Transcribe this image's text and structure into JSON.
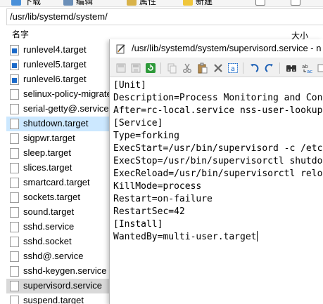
{
  "toolbar": {
    "download_label": "下载",
    "edit_label": "编辑",
    "properties_label": "属性",
    "new_label": "新建"
  },
  "path": "/usr/lib/systemd/system/",
  "columns": {
    "name": "名字",
    "size": "大小"
  },
  "files": [
    {
      "name": "runlevel4.target",
      "link": true
    },
    {
      "name": "runlevel5.target",
      "link": true
    },
    {
      "name": "runlevel6.target",
      "link": true
    },
    {
      "name": "selinux-policy-migrate",
      "link": false
    },
    {
      "name": "serial-getty@.service",
      "link": false
    },
    {
      "name": "shutdown.target",
      "link": false
    },
    {
      "name": "sigpwr.target",
      "link": false
    },
    {
      "name": "sleep.target",
      "link": false
    },
    {
      "name": "slices.target",
      "link": false
    },
    {
      "name": "smartcard.target",
      "link": false
    },
    {
      "name": "sockets.target",
      "link": false
    },
    {
      "name": "sound.target",
      "link": false
    },
    {
      "name": "sshd.service",
      "link": false
    },
    {
      "name": "sshd.socket",
      "link": false
    },
    {
      "name": "sshd@.service",
      "link": false
    },
    {
      "name": "sshd-keygen.service",
      "link": false
    },
    {
      "name": "supervisord.service",
      "link": false
    },
    {
      "name": "suspend.target",
      "link": false
    }
  ],
  "editor": {
    "title": "/usr/lib/systemd/system/supervisord.service - n",
    "lines": [
      "[Unit]",
      "Description=Process Monitoring and Con",
      "After=rc-local.service nss-user-lookup",
      "[Service]",
      "Type=forking",
      "ExecStart=/usr/bin/supervisord -c /etc",
      "ExecStop=/usr/bin/supervisorctl shutdo",
      "ExecReload=/usr/bin/supervisorctl relo",
      "KillMode=process",
      "Restart=on-failure",
      "RestartSec=42",
      "[Install]",
      "WantedBy=multi-user.target"
    ]
  },
  "colors": {
    "selected_row": "#cce8ff",
    "active_row": "#d9d9d9",
    "accent": "#1b6ac9"
  }
}
